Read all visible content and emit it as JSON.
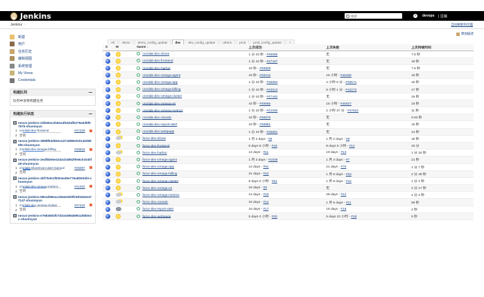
{
  "header": {
    "title": "Jenkins",
    "search_placeholder": "搜索",
    "user": "devops",
    "logout": "| 注销"
  },
  "breadcrumb": {
    "root": "Jenkins",
    "arrow": "›",
    "auto_refresh": "自动刷新的页面"
  },
  "sidebar": {
    "tasks": [
      {
        "label": "新建",
        "icon": "new-item-icon",
        "color": "#e8c070"
      },
      {
        "label": "用户",
        "icon": "people-icon",
        "color": "#8a6d4a"
      },
      {
        "label": "任务历史",
        "icon": "build-history-icon",
        "color": "#c9a56c"
      },
      {
        "label": "编辑视图",
        "icon": "edit-view-icon",
        "color": "#b09060"
      },
      {
        "label": "系统管理",
        "icon": "manage-icon",
        "color": "#888888"
      },
      {
        "label": "My Views",
        "icon": "my-views-icon",
        "color": "#c9b67a"
      },
      {
        "label": "Credentials",
        "icon": "credentials-icon",
        "color": "#777777"
      }
    ],
    "queue": {
      "title": "构建队列",
      "empty": "队列中没有构建任务"
    },
    "executors": {
      "title": "构建执行状态",
      "nodes": [
        {
          "name": "nexus-jenkins-2db60ec2b9ea4fe6d4fb279a0d9f57679-shunmyun",
          "job": "cronlab-dev-frontend",
          "build": "#47429",
          "progress": 0.35
        },
        {
          "name": "nexus-jenkins-3898f94d563c4371898e0201a9d085f6-shunmyun",
          "job": "cronlab-dev-omega-billing",
          "build": "#43515",
          "progress": 0.55
        },
        {
          "name": "nexus-jenkins-3e4f8de5e4344cb4862f9e8c01540f28-shunmyun",
          "job": "cronlab-shunmyun-user-manual",
          "build": "#25087",
          "progress": 0.2
        },
        {
          "name": "nexus-jenkins-4bf7bde1f8304ed6e776a9b934f4-shunmyun",
          "job": "cronlab-dev-omega-metrics",
          "build": "#41002",
          "progress": 0.6
        },
        {
          "name": "nexus-jenkins-98ead96eacd454e0b9f19d0453e477147-shunmyun",
          "job": "cronlab-dev-omega-cluster",
          "build": "#47442",
          "progress": 0.3
        },
        {
          "name": "nexus-jenkins-e7983592f07d3c6d9649951d580e3c-shunmyun",
          "job": "",
          "build": "",
          "progress": 0
        }
      ],
      "slot1": "1",
      "slot2": "2",
      "idle": "空闲"
    }
  },
  "main": {
    "add_description": "添加描述",
    "tabs": [
      "All",
      "demo",
      "demo_config_update",
      "dev",
      "dev_config_update",
      "others",
      "prod",
      "prod_config_update",
      "+"
    ],
    "active_tab": "dev",
    "columns": {
      "s": "S",
      "w": "W",
      "name": "Name ↓",
      "last_success": "上次成功",
      "last_failure": "上次失败",
      "last_duration": "上次持续时间"
    },
    "jobs": [
      {
        "name": "cronlab-dev-drone",
        "weather": "sun",
        "ls_text": "1 分 43 秒 - ",
        "ls_build": "#46586",
        "lf_text": "无",
        "lf_build": "",
        "ld": "7.5 秒"
      },
      {
        "name": "cronlab-dev-frontend",
        "weather": "sun",
        "ls_text": "1 分 43 秒 - ",
        "ls_build": "#47427",
        "lf_text": "无",
        "lf_build": "",
        "ld": "18 秒"
      },
      {
        "name": "cronlab-dev-harbor",
        "weather": "sun",
        "ls_text": "43 秒 - ",
        "ls_build": "#49808",
        "lf_text": "无",
        "lf_build": "",
        "ld": "7.5 秒"
      },
      {
        "name": "cronlab-dev-omega-agent",
        "weather": "sun",
        "ls_text": "43 秒 - ",
        "ls_build": "#48212",
        "lf_text": "15 小时 - ",
        "lf_build": "#46456",
        "ld": "18 秒"
      },
      {
        "name": "cronlab-dev-omega-app",
        "weather": "sun",
        "ls_text": "1 分 43 秒 - ",
        "ls_build": "#49894",
        "lf_text": "4 小时 8 分 - ",
        "lf_build": "#49571",
        "ld": "18 秒"
      },
      {
        "name": "cronlab-dev-omega-billing",
        "weather": "sun",
        "ls_text": "1 分 43 秒 - ",
        "ls_build": "#43513",
        "lf_text": "8 小时 1 分 - ",
        "lf_build": "#43273",
        "ld": "17 秒"
      },
      {
        "name": "cronlab-dev-omega-cluster",
        "weather": "sun",
        "ls_text": "1 分 43 秒 - ",
        "ls_build": "#47440",
        "lf_text": "无",
        "lf_build": "",
        "ld": "16 秒"
      },
      {
        "name": "cronlab-dev-omega-es",
        "weather": "sun",
        "ls_text": "43 秒 - ",
        "ls_build": "#49865",
        "lf_text": "15 小时 - ",
        "lf_build": "#45927",
        "ld": "16 秒"
      },
      {
        "name": "cronlab-dev-omega-metrics",
        "weather": "sun",
        "ls_text": "1 分 43 秒 - ",
        "ls_build": "#41000",
        "lf_text": "2 小时 37 分 - ",
        "lf_build": "#47622",
        "ld": "11 秒"
      },
      {
        "name": "cronlab-dev-oneaitc",
        "weather": "sun",
        "ls_text": "43 秒 - ",
        "ls_build": "#49979",
        "lf_text": "无",
        "lf_build": "",
        "ld": "0.63 秒"
      },
      {
        "name": "cronlab-dev-report-alert",
        "weather": "sun",
        "ls_text": "43 秒 - ",
        "ls_build": "#49881",
        "lf_text": "无",
        "lf_build": "",
        "ld": "15 秒"
      },
      {
        "name": "cronlab-dev-webpage",
        "weather": "sun",
        "ls_text": "1 分 43 秒 - ",
        "ls_build": "#46881",
        "lf_text": "无",
        "lf_build": "",
        "ld": "14 秒"
      },
      {
        "name": "force-dev-drone",
        "weather": "cloud",
        "ls_text": "1 月 2 days - ",
        "ls_build": "#6",
        "lf_text": "1 月 2 days - ",
        "lf_build": "#8",
        "ld": "18 秒"
      },
      {
        "name": "force-dev-frontend",
        "weather": "sun",
        "ls_text": "5 days 8 小时 - ",
        "ls_build": "#18",
        "lf_text": "8 days 8 小时 - ",
        "lf_build": "#12",
        "ld": "43 分"
      },
      {
        "name": "force-dev-harbor",
        "weather": "cloud",
        "ls_text": "14 days - ",
        "ls_build": "#11",
        "lf_text": "19 days - ",
        "lf_build": "#13",
        "ld": "1 分 34 秒"
      },
      {
        "name": "force-dev-omega-agent",
        "weather": "sun",
        "ls_text": "1 月 3 days - ",
        "ls_build": "#1639",
        "lf_text": "1 月 4 days - ",
        "lf_build": "#7",
        "ld": "21 秒"
      },
      {
        "name": "force-dev-omega-app",
        "weather": "sun",
        "ls_text": "14 days - ",
        "ls_build": "#81",
        "lf_text": "21 days - ",
        "lf_build": "#75",
        "ld": "1 分 7 秒"
      },
      {
        "name": "force-dev-omega-billing",
        "weather": "sun",
        "ls_text": "21 days - ",
        "ls_build": "#22",
        "lf_text": "1 月 6 days - ",
        "lf_build": "#16",
        "ld": "2 分 48 秒"
      },
      {
        "name": "force-dev-omega-cluster",
        "weather": "sun",
        "ls_text": "8 days 6 小时 - ",
        "ls_build": "#51",
        "lf_text": "1 月 8 days - ",
        "lf_build": "#44",
        "ld": "1 分 2 秒"
      },
      {
        "name": "force-dev-omega-es",
        "weather": "sun",
        "ls_text": "16 days - ",
        "ls_build": "#8",
        "lf_text": "无",
        "lf_build": "",
        "ld": "2 分 17 秒"
      },
      {
        "name": "force-dev-omega-metrics",
        "weather": "cloud",
        "ls_text": "14 days - ",
        "ls_build": "#16",
        "lf_text": "28 days - ",
        "lf_build": "#12",
        "ld": "1 分 2 秒"
      },
      {
        "name": "force-dev-oneaitc",
        "weather": "cloud",
        "ls_text": "16 days - ",
        "ls_build": "#14",
        "lf_text": "1 月 5 days - ",
        "lf_build": "#11",
        "ld": "59 秒"
      },
      {
        "name": "force-dev-report-alert",
        "weather": "storm",
        "ls_text": "16 days - ",
        "ls_build": "#17",
        "lf_text": "16 days - ",
        "lf_build": "#18",
        "ld": "2 秒"
      },
      {
        "name": "force-dev-webpage",
        "weather": "sun",
        "ls_text": "5 days 2 小时 - ",
        "ls_build": "#20",
        "lf_text": "5 days 22 小时 - ",
        "lf_build": "#18",
        "ld": "5 秒"
      }
    ]
  }
}
